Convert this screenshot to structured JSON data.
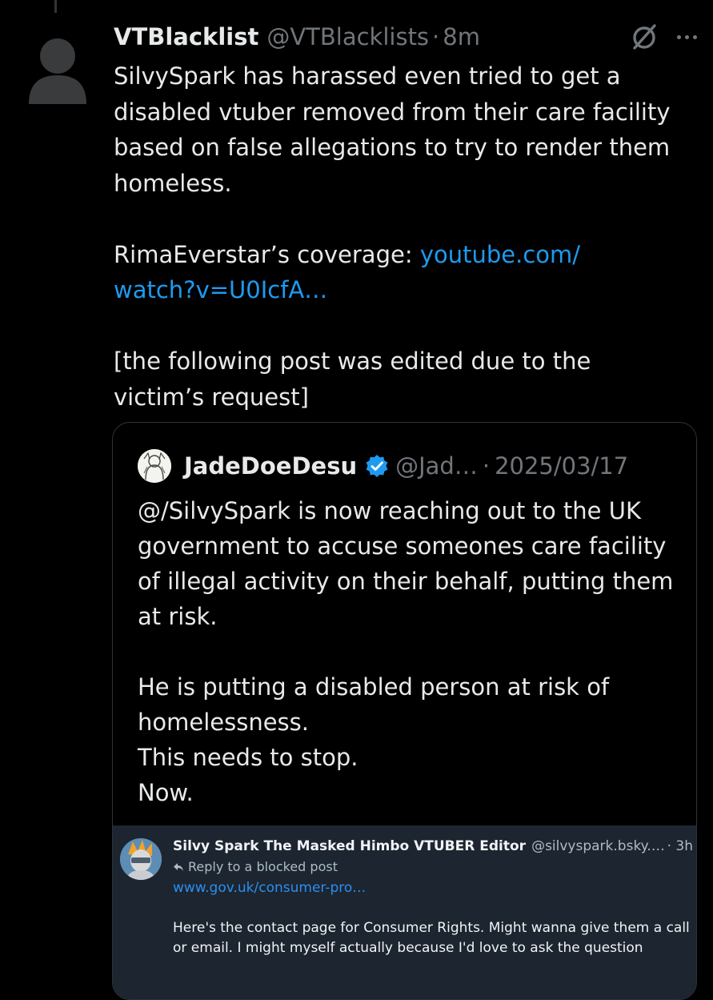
{
  "post": {
    "author": {
      "display_name": "VTBlacklist",
      "handle": "@VTBlacklists",
      "separator": "·",
      "time": "8m"
    },
    "icons": {
      "grok": "grok-icon",
      "more": "more-options-icon"
    },
    "body": {
      "line1": "SilvySpark has harassed even tried to get a disabled vtuber removed from their care facility based on false allegations to try to render them homeless.",
      "coverage_prefix": "RimaEverstar’s coverage: ",
      "coverage_link": "youtube.com/\nwatch?v=U0IcfA…",
      "edit_note": "[the following post was edited due to the victim’s request]"
    }
  },
  "quote": {
    "author": {
      "display_name": "JadeDoeDesu",
      "handle": "@Jad…",
      "separator": "·",
      "date": "2025/03/17"
    },
    "body": {
      "para1": "@/SilvySpark is now reaching out to the UK government to accuse someones care facility of illegal activity on their behalf, putting them at risk.",
      "line_a": "He is putting a disabled person at risk of homelessness.",
      "line_b": "This needs to stop.",
      "line_c": "Now."
    },
    "embed": {
      "author": "Silvy Spark The Masked Himbo VTUBER Editor",
      "handle": "@silvyspark.bsky.…",
      "time": "· 3h",
      "reply_note": "Reply to a blocked post",
      "link": "www.gov.uk/consumer-pro…",
      "body": "Here's the contact page for Consumer Rights. Might wanna give them a call or email. I might myself actually because I'd love to ask the question"
    }
  },
  "colors": {
    "background": "#000000",
    "text": "#e7e9ea",
    "muted": "#71767b",
    "link": "#1d9bf0",
    "verified": "#1d9bf0",
    "embed_background": "#1c2530"
  }
}
